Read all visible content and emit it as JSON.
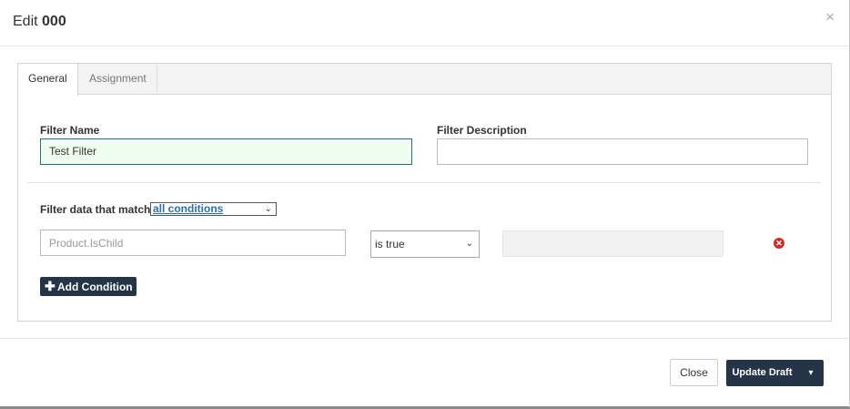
{
  "modal": {
    "title_prefix": "Edit",
    "title_name": "000",
    "close_symbol": "×"
  },
  "tabs": [
    {
      "label": "General",
      "active": true
    },
    {
      "label": "Assignment",
      "active": false
    }
  ],
  "form": {
    "filter_name_label": "Filter Name",
    "filter_name_value": "Test Filter",
    "filter_description_label": "Filter Description",
    "filter_description_value": "",
    "match_label": "Filter data that match",
    "match_selected": "all conditions"
  },
  "condition": {
    "field_placeholder": "Product.IsChild",
    "operator": "is true",
    "value": ""
  },
  "buttons": {
    "add_condition": "Add Condition",
    "close": "Close",
    "update_draft": "Update Draft"
  },
  "icons": {
    "close": "close-icon",
    "chevron": "chevron-down-icon",
    "remove": "remove-circle-icon",
    "plus": "plus-icon",
    "caret": "caret-down-icon"
  },
  "colors": {
    "primary_button": "#263447",
    "focused_input_bg": "#effcef",
    "link": "#2a6fb0",
    "danger": "#c9302c"
  }
}
